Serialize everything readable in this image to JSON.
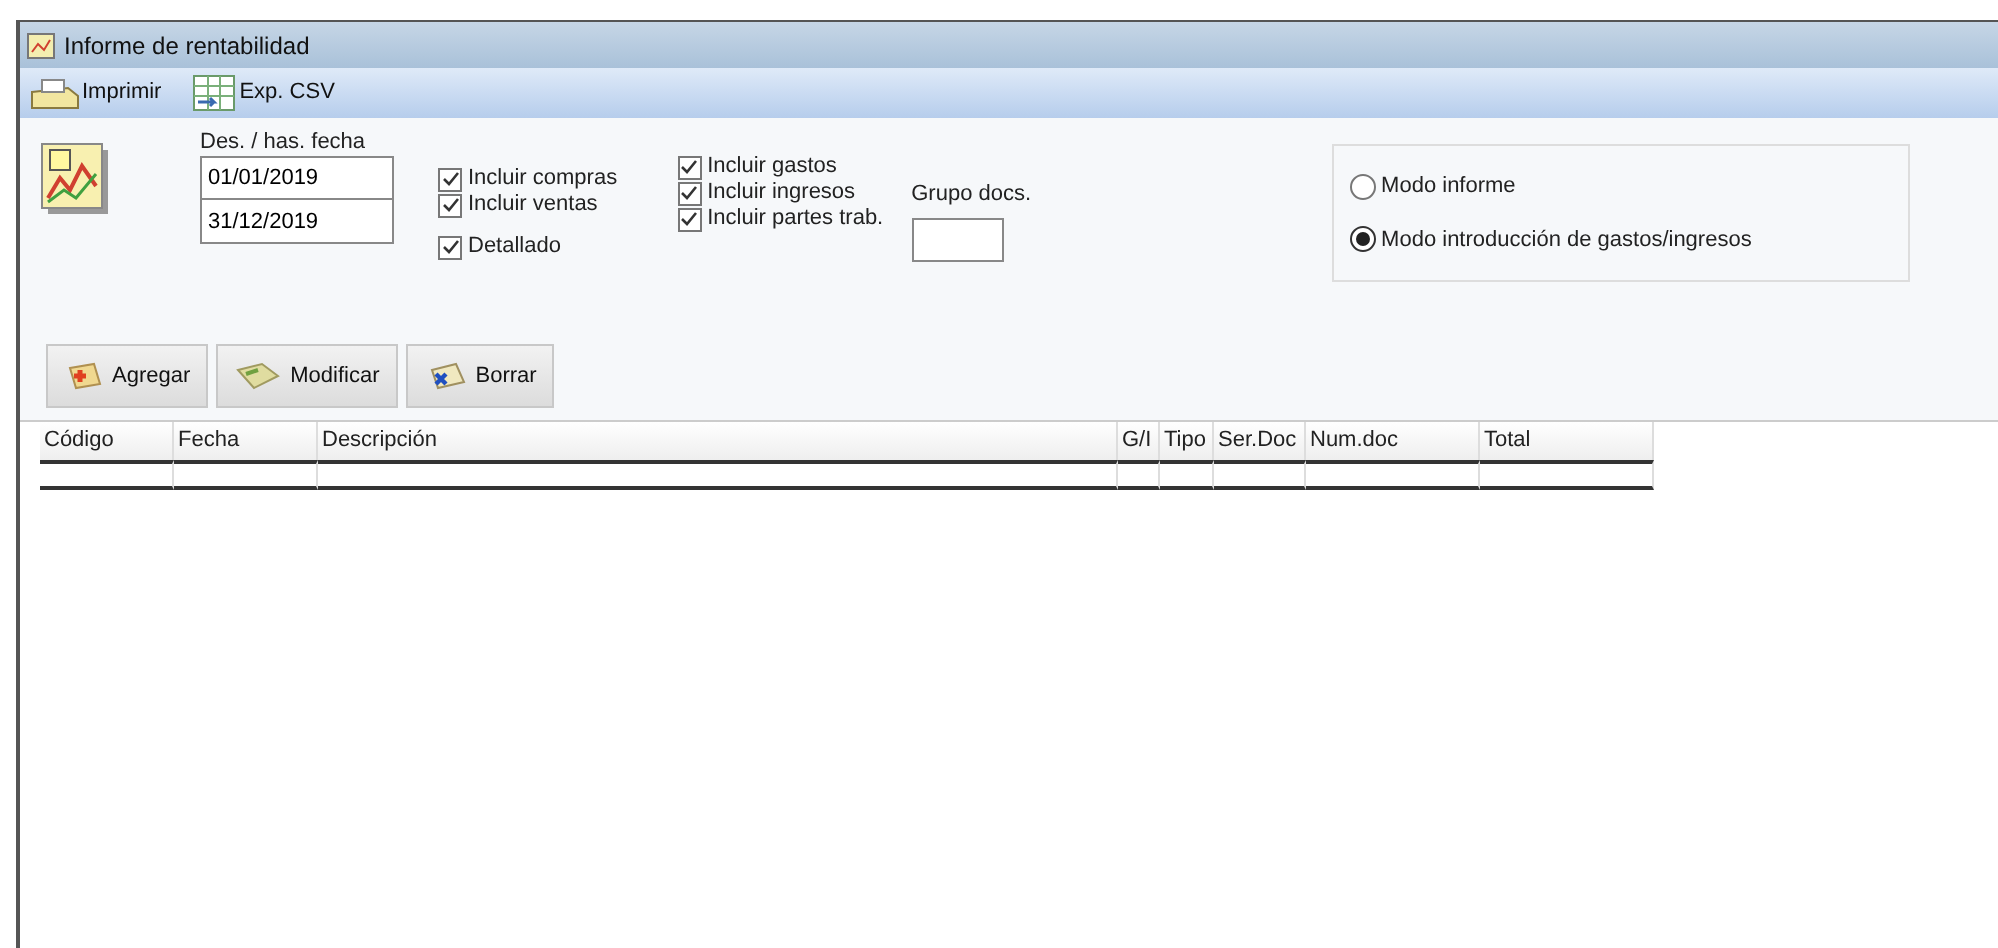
{
  "window": {
    "title": "Informe de rentabilidad"
  },
  "toolbar": [
    {
      "label": "Imprimir",
      "kind": "print"
    },
    {
      "label": "Exp. CSV",
      "kind": "csv"
    }
  ],
  "date_range": {
    "label": "Des. / has. fecha",
    "from": "01/01/2019",
    "to": "31/12/2019"
  },
  "options_col1": [
    {
      "label": "Incluir compras",
      "checked": true
    },
    {
      "label": "Incluir ventas",
      "checked": true
    }
  ],
  "detailed": {
    "label": "Detallado",
    "checked": true
  },
  "options_col2": [
    {
      "label": "Incluir gastos",
      "checked": true
    },
    {
      "label": "Incluir ingresos",
      "checked": true
    },
    {
      "label": "Incluir partes trab.",
      "checked": true
    }
  ],
  "group_docs": {
    "label": "Grupo docs."
  },
  "modes": [
    {
      "label": "Modo informe",
      "selected": false
    },
    {
      "label": "Modo introducción de gastos/ingresos",
      "selected": true
    }
  ],
  "actions": [
    {
      "label": "Agregar",
      "kind": "add"
    },
    {
      "label": "Modificar",
      "kind": "edit"
    },
    {
      "label": "Borrar",
      "kind": "delete"
    }
  ],
  "table": {
    "columns": [
      "Código",
      "Fecha",
      "Descripción",
      "G/I",
      "Tipo",
      "Ser.Doc",
      "Num.doc",
      "Total"
    ]
  }
}
